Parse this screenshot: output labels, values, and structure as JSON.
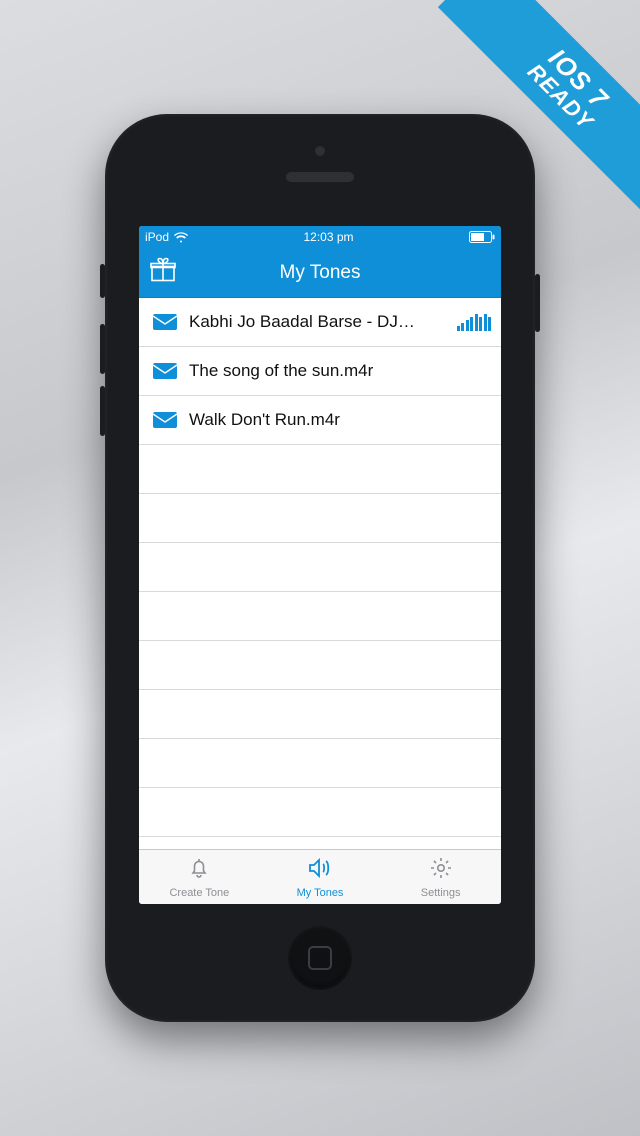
{
  "ribbon": {
    "line1": "IOS 7",
    "line2": "READY"
  },
  "status": {
    "carrier": "iPod",
    "time": "12:03 pm"
  },
  "nav": {
    "title": "My Tones"
  },
  "tones": [
    {
      "title": "Kabhi Jo Baadal Barse - DJ…",
      "playing": true
    },
    {
      "title": "The song of the sun.m4r",
      "playing": false
    },
    {
      "title": "Walk Don't Run.m4r",
      "playing": false
    }
  ],
  "tabs": {
    "create": "Create Tone",
    "my": "My Tones",
    "settings": "Settings"
  },
  "colors": {
    "accent": "#0f8fd8"
  }
}
